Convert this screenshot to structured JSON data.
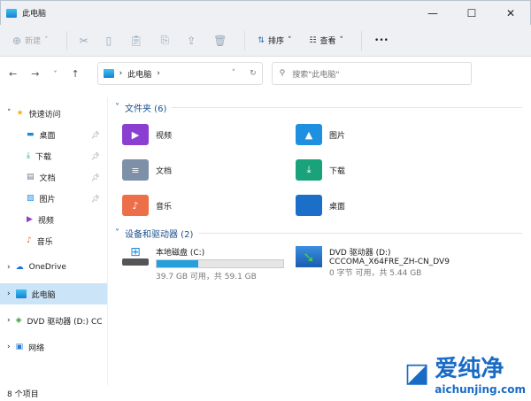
{
  "window": {
    "title": "此电脑",
    "minimize": "—",
    "maximize": "☐",
    "close": "✕"
  },
  "toolbar": {
    "new": "新建",
    "sort": "排序",
    "view": "查看",
    "more": "•••"
  },
  "address": {
    "path": "此电脑",
    "search_placeholder": "搜索\"此电脑\""
  },
  "sidebar": {
    "quick": "快速访问",
    "items": [
      "桌面",
      "下载",
      "文档",
      "图片",
      "视频",
      "音乐"
    ],
    "onedrive": "OneDrive",
    "thispc": "此电脑",
    "dvd": "DVD 驱动器 (D:) CC",
    "network": "网络"
  },
  "folders": {
    "header": "文件夹 (6)",
    "items": [
      "视频",
      "图片",
      "文档",
      "下载",
      "音乐",
      "桌面"
    ]
  },
  "drives": {
    "header": "设备和驱动器 (2)",
    "c": {
      "name": "本地磁盘 (C:)",
      "info": "39.7 GB 可用，共 59.1 GB",
      "used_fraction": 0.33
    },
    "d": {
      "name": "DVD 驱动器 (D:)",
      "label": "CCCOMA_X64FRE_ZH-CN_DV9",
      "info": "0 字节 可用，共 5.44 GB"
    }
  },
  "status": {
    "count": "8 个项目"
  },
  "watermark": {
    "brand": "爱纯净",
    "url": "aichunjing.com"
  }
}
